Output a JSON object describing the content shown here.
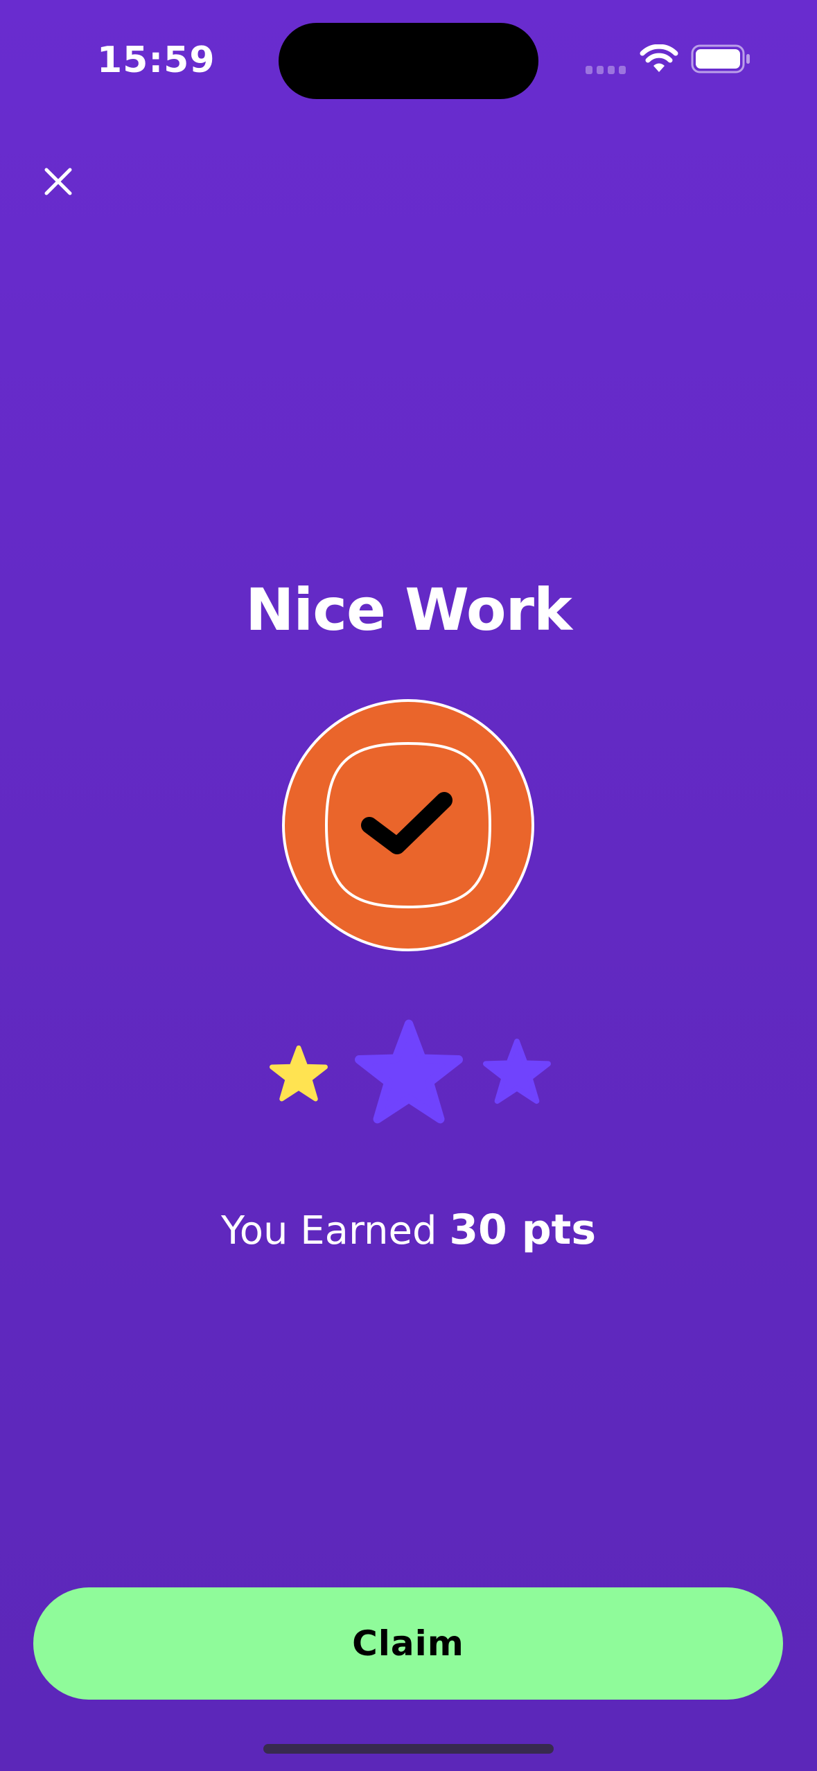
{
  "status_bar": {
    "time": "15:59",
    "icons": [
      "cellular-signal-icon",
      "wifi-icon",
      "battery-icon"
    ]
  },
  "header": {
    "close_icon": "close-icon"
  },
  "main": {
    "title": "Nice Work",
    "badge_icon": "checkmark-badge-icon",
    "rating": {
      "filled": 1,
      "total": 3
    },
    "earned_prefix": "You Earned",
    "earned_points": "30 pts"
  },
  "footer": {
    "claim_label": "Claim"
  },
  "colors": {
    "background_top": "#692ccf",
    "background_bottom": "#5c27b9",
    "badge": "#ea652b",
    "star_filled": "#ffe351",
    "star_empty": "#7043fd",
    "claim_button": "#8ffb9a"
  }
}
